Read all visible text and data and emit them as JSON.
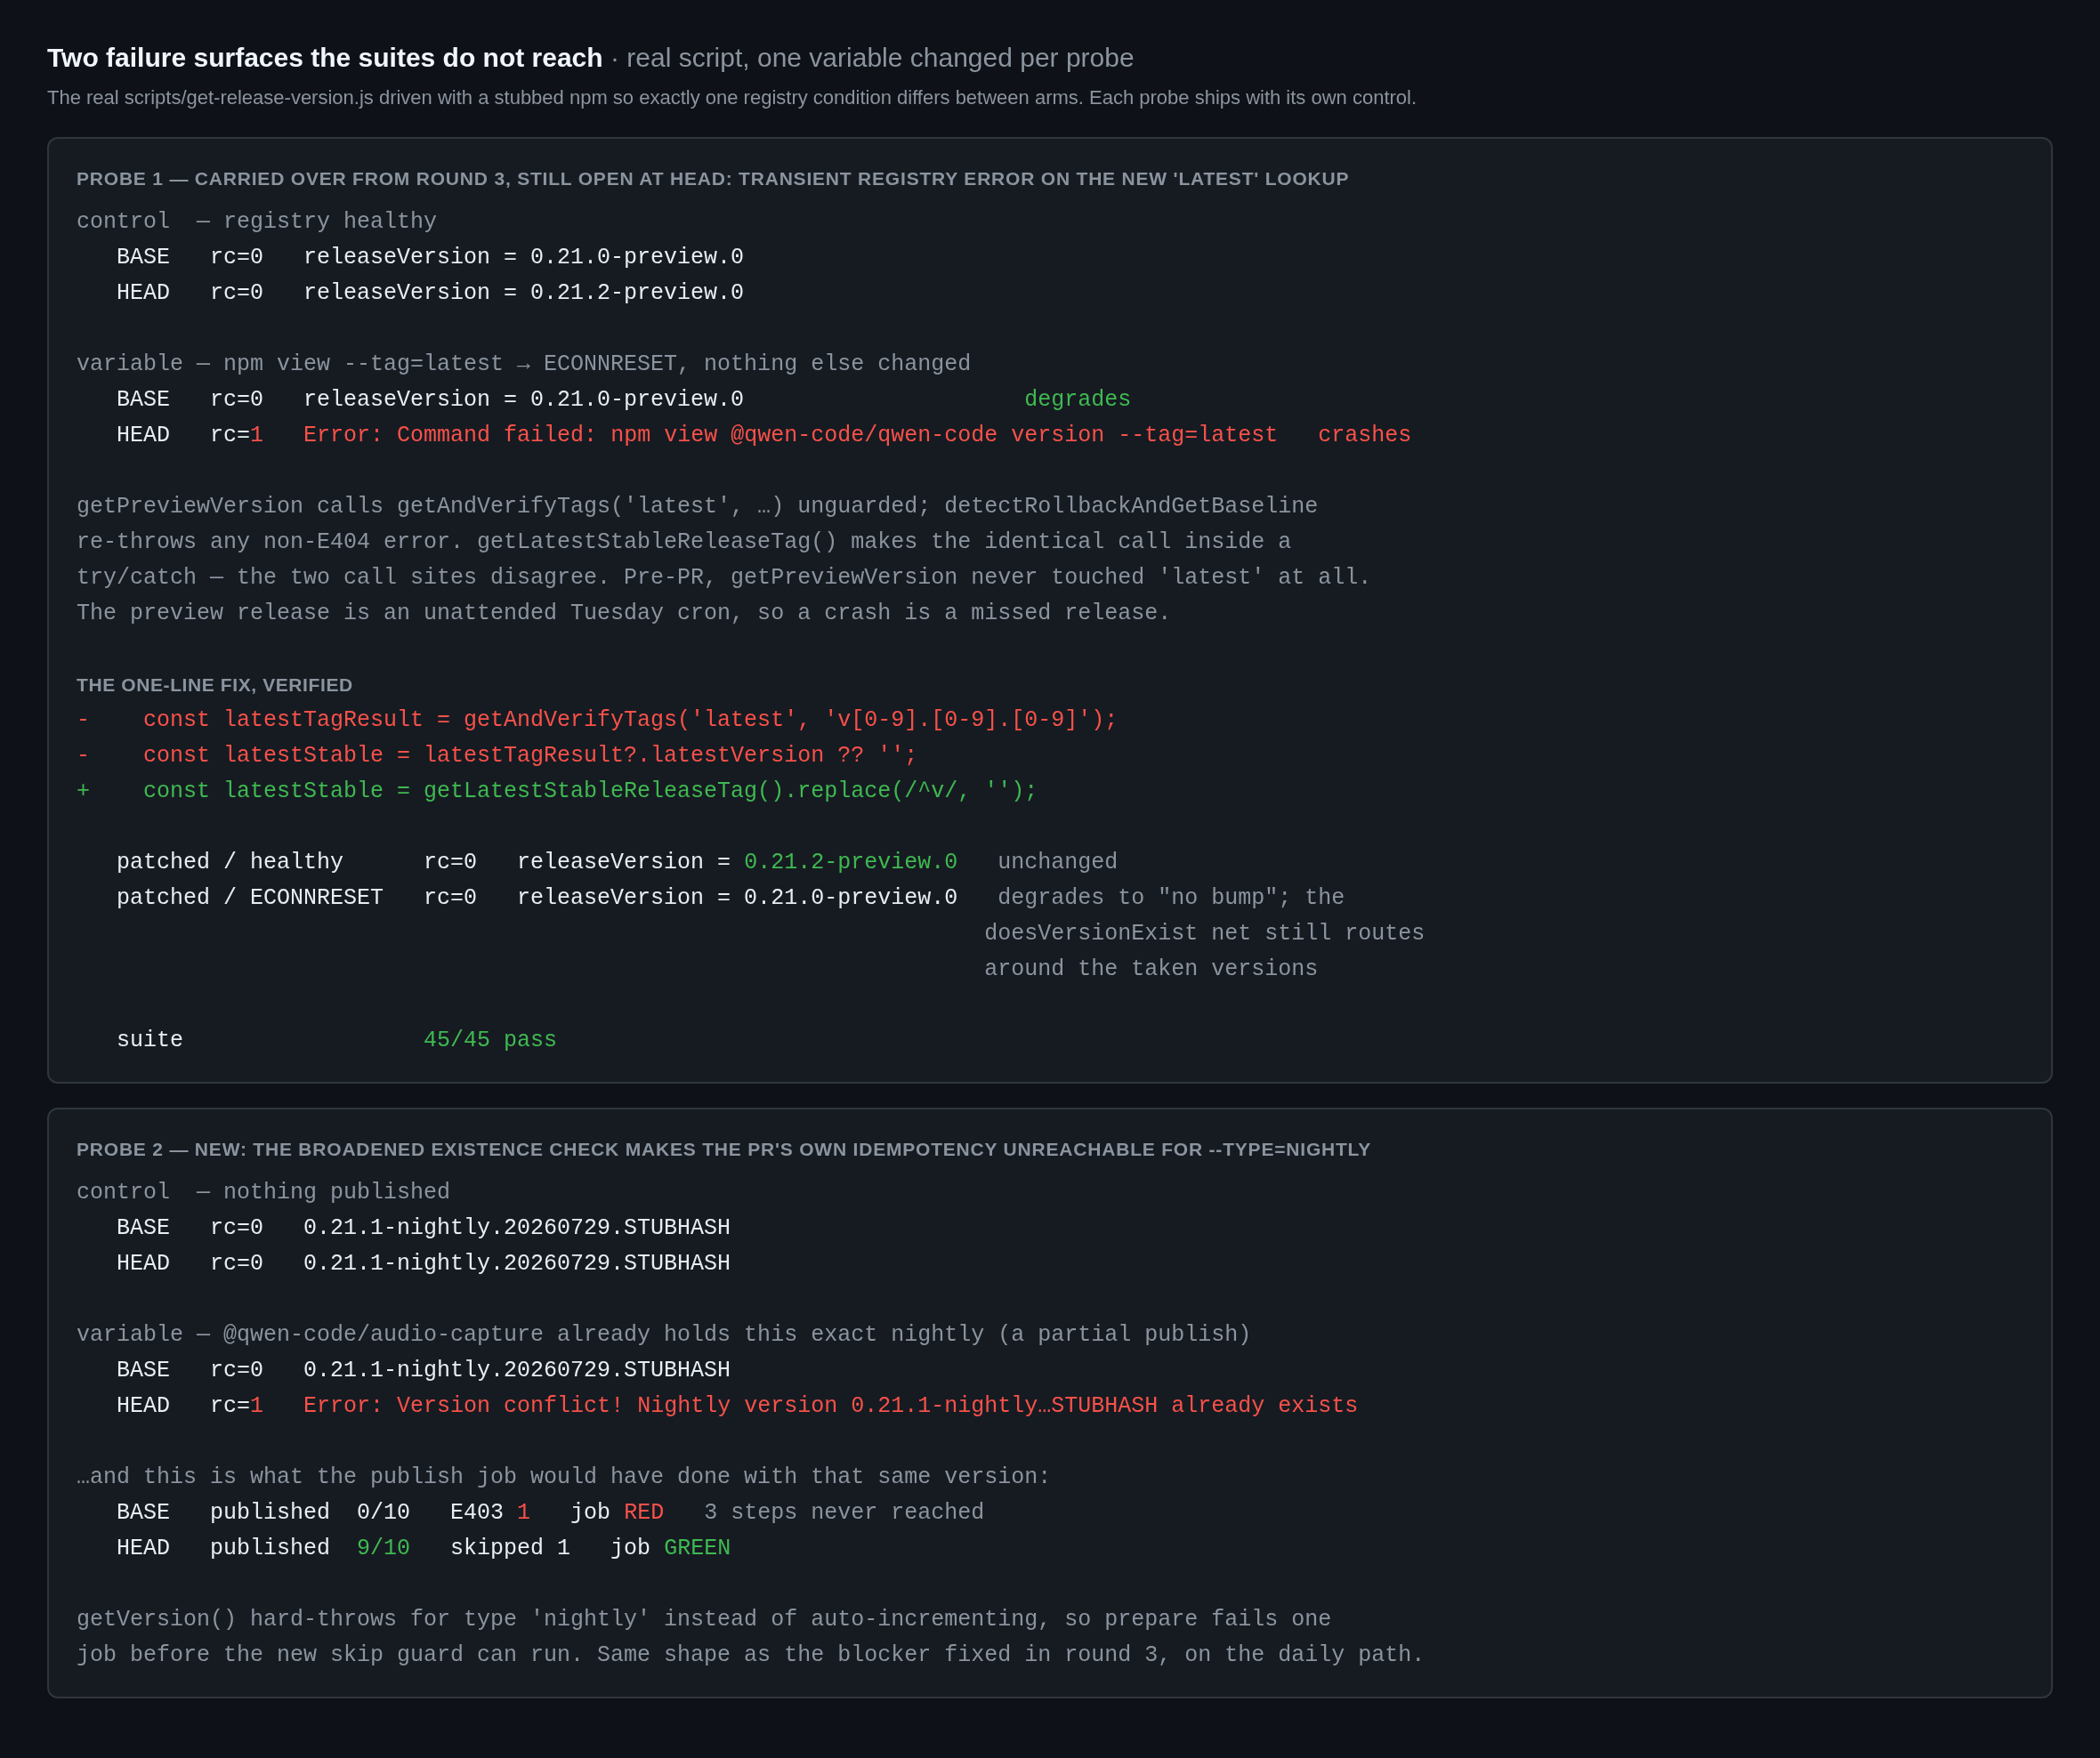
{
  "header": {
    "title": "**Two failure surfaces the suites do not reach** · real script, one variable changed per probe",
    "caption": "The real scripts/get-release-version.js driven with a stubbed npm so exactly one registry condition differs between arms. Each probe ships with its own control."
  },
  "probes": [
    {
      "title": "PROBE 1 — CARRIED OVER FROM ROUND 3, STILL OPEN AT HEAD: TRANSIENT REGISTRY ERROR ON THE NEW 'LATEST' LOOKUP",
      "blocks": [
        {
          "lines": [
            [
              {
                "text": "control  — registry healthy",
                "kind": "dim"
              }
            ],
            [
              {
                "text": "   BASE   rc=0   releaseVersion = 0.21.0-preview.0",
                "kind": "plain"
              }
            ],
            [
              {
                "text": "   HEAD   rc=0   releaseVersion = 0.21.2-preview.0",
                "kind": "plain"
              }
            ]
          ]
        },
        {
          "lines": [
            [
              {
                "text": "variable — npm view --tag=latest → ECONNRESET, nothing else changed",
                "kind": "dim"
              }
            ],
            [
              {
                "text": "   BASE   rc=0   releaseVersion = 0.21.0-preview.0                     ",
                "kind": "plain"
              },
              {
                "text": "degrades",
                "kind": "green"
              }
            ],
            [
              {
                "text": "   HEAD   rc=",
                "kind": "plain"
              },
              {
                "text": "1",
                "kind": "red"
              },
              {
                "text": "   Error: Command failed: npm view @qwen-code/qwen-code version --tag=latest   crashes",
                "kind": "red"
              }
            ]
          ]
        },
        {
          "lines": [
            [
              {
                "text": "getPreviewVersion calls getAndVerifyTags('latest', …) unguarded; detectRollbackAndGetBaseline",
                "kind": "dim"
              }
            ],
            [
              {
                "text": "re-throws any non-E404 error. getLatestStableReleaseTag() makes the identical call inside a",
                "kind": "dim"
              }
            ],
            [
              {
                "text": "try/catch — the two call sites disagree. Pre-PR, getPreviewVersion never touched 'latest' at all.",
                "kind": "dim"
              }
            ],
            [
              {
                "text": "The preview release is an unattended Tuesday cron, so a crash is a missed release.",
                "kind": "dim"
              }
            ]
          ]
        },
        {
          "heading": "THE ONE-LINE FIX, VERIFIED",
          "lines": [
            [
              {
                "text": "-    const latestTagResult = getAndVerifyTags('latest', 'v[0-9].[0-9].[0-9]');",
                "kind": "red"
              }
            ],
            [
              {
                "text": "-    const latestStable = latestTagResult?.latestVersion ?? '';",
                "kind": "red"
              }
            ],
            [
              {
                "text": "+    const latestStable = getLatestStableReleaseTag().replace(/^v/, '');",
                "kind": "green"
              }
            ]
          ]
        },
        {
          "lines": [
            [
              {
                "text": "   patched / healthy      rc=0   releaseVersion = ",
                "kind": "plain"
              },
              {
                "text": "0.21.2-preview.0",
                "kind": "green"
              },
              {
                "text": "   unchanged",
                "kind": "dim"
              }
            ],
            [
              {
                "text": "   patched / ECONNRESET   rc=0   releaseVersion = 0.21.0-preview.0",
                "kind": "plain"
              },
              {
                "text": "   degrades to \"no bump\"; the",
                "kind": "dim"
              }
            ],
            [
              {
                "text": "                                                                    doesVersionExist net still routes",
                "kind": "dim"
              }
            ],
            [
              {
                "text": "                                                                    around the taken versions",
                "kind": "dim"
              }
            ]
          ]
        },
        {
          "lines": [
            [
              {
                "text": "   suite                  ",
                "kind": "plain"
              },
              {
                "text": "45/45 pass",
                "kind": "green"
              }
            ]
          ]
        }
      ]
    },
    {
      "title": "PROBE 2 — NEW: THE BROADENED EXISTENCE CHECK MAKES THE PR'S OWN IDEMPOTENCY UNREACHABLE FOR --TYPE=NIGHTLY",
      "blocks": [
        {
          "lines": [
            [
              {
                "text": "control  — nothing published",
                "kind": "dim"
              }
            ],
            [
              {
                "text": "   BASE   rc=0   0.21.1-nightly.20260729.STUBHASH",
                "kind": "plain"
              }
            ],
            [
              {
                "text": "   HEAD   rc=0   0.21.1-nightly.20260729.STUBHASH",
                "kind": "plain"
              }
            ]
          ]
        },
        {
          "lines": [
            [
              {
                "text": "variable — @qwen-code/audio-capture already holds this exact nightly (a partial publish)",
                "kind": "dim"
              }
            ],
            [
              {
                "text": "   BASE   rc=0   0.21.1-nightly.20260729.STUBHASH",
                "kind": "plain"
              }
            ],
            [
              {
                "text": "   HEAD   rc=",
                "kind": "plain"
              },
              {
                "text": "1",
                "kind": "red"
              },
              {
                "text": "   Error: Version conflict! Nightly version 0.21.1-nightly…STUBHASH already exists",
                "kind": "red"
              }
            ]
          ]
        },
        {
          "lines": [
            [
              {
                "text": "…and this is what the publish job would have done with that same version:",
                "kind": "dim"
              }
            ],
            [
              {
                "text": "   BASE   published  0/10   E403 ",
                "kind": "plain"
              },
              {
                "text": "1",
                "kind": "red"
              },
              {
                "text": "   job ",
                "kind": "plain"
              },
              {
                "text": "RED",
                "kind": "red"
              },
              {
                "text": "   3 steps never reached",
                "kind": "dim"
              }
            ],
            [
              {
                "text": "   HEAD   published  ",
                "kind": "plain"
              },
              {
                "text": "9/10",
                "kind": "green"
              },
              {
                "text": "   skipped 1   job ",
                "kind": "plain"
              },
              {
                "text": "GREEN",
                "kind": "green"
              }
            ]
          ]
        },
        {
          "lines": [
            [
              {
                "text": "getVersion() hard-throws for type 'nightly' instead of auto-incrementing, so prepare fails one",
                "kind": "dim"
              }
            ],
            [
              {
                "text": "job before the new skip guard can run. Same shape as the blocker fixed in round 3, on the daily path.",
                "kind": "dim"
              }
            ]
          ]
        }
      ]
    }
  ]
}
